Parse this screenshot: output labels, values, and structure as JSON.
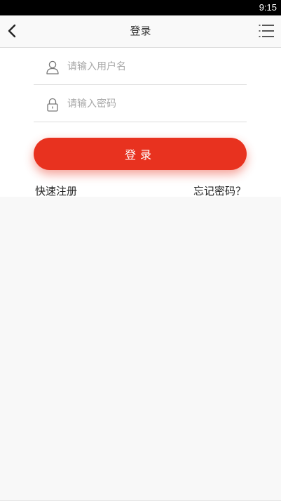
{
  "status_bar": {
    "time": "9:15"
  },
  "header": {
    "title": "登录",
    "back_icon": "chevron-left-icon",
    "menu_icon": "menu-list-icon"
  },
  "form": {
    "username": {
      "placeholder": "请输入用户名",
      "value": "",
      "icon": "user-icon"
    },
    "password": {
      "placeholder": "请输入密码",
      "value": "",
      "icon": "lock-icon"
    },
    "login_label": "登录"
  },
  "links": {
    "register": "快速注册",
    "forgot": "忘记密码？"
  },
  "colors": {
    "accent": "#e8321f",
    "status_bar": "#000000",
    "page_bg": "#f8f8f8"
  }
}
